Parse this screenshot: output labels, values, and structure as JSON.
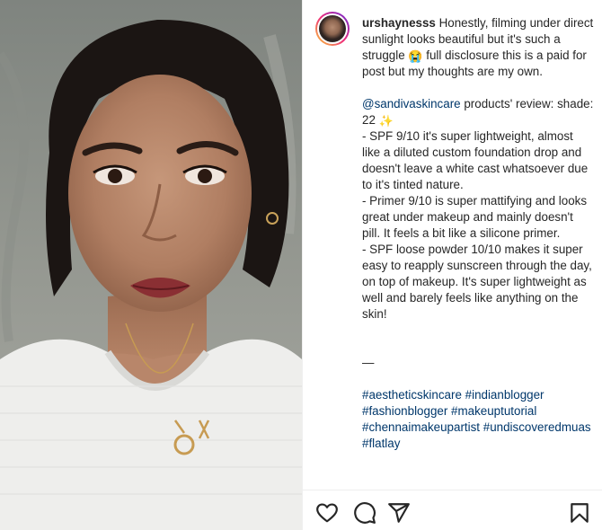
{
  "post": {
    "username": "urshaynesss",
    "caption_intro": " Honestly, filming under direct sunlight looks beautiful but it's such a struggle ",
    "caption_intro_emoji": "😭",
    "caption_intro_end": " full disclosure this is a paid for post but my thoughts are my own.",
    "mention": "@sandivaskincare",
    "review_intro": " products' review: shade: 22 ",
    "review_intro_emoji": "✨",
    "review_items": [
      "- SPF 9/10 it's super lightweight, almost like a diluted custom foundation drop and doesn't leave a white cast whatsoever due to it's tinted nature.",
      "- Primer 9/10 is super mattifying and looks great under makeup and mainly doesn't pill. It feels a bit like a silicone primer.",
      "- SPF loose powder 10/10 makes it super easy to reapply sunscreen through the day, on top of makeup. It's super lightweight as well and barely feels like anything on the skin!"
    ],
    "separator": "—",
    "hashtags": [
      "#aestheticskincare",
      "#indianblogger",
      "#fashionblogger",
      "#makeuptutorial",
      "#chennaimakeupartist",
      "#undiscoveredmuas",
      "#flatlay"
    ]
  },
  "actions": {
    "like_icon": "heart-icon",
    "comment_icon": "comment-bubble-icon",
    "share_icon": "paper-plane-icon",
    "save_icon": "bookmark-icon"
  },
  "colors": {
    "text": "#262626",
    "link": "#00376b",
    "border": "#efefef"
  }
}
